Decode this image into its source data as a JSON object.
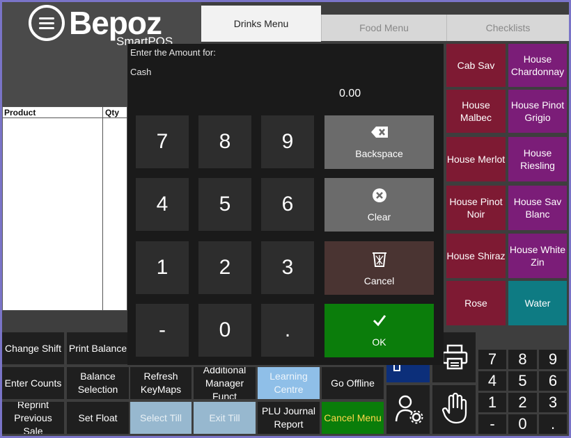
{
  "logo": {
    "brand": "Bepoz",
    "sub": "SmartPOS"
  },
  "tabs": [
    {
      "label": "Drinks Menu",
      "active": true
    },
    {
      "label": "Food Menu",
      "active": false
    },
    {
      "label": "Checklists",
      "active": false
    }
  ],
  "order": {
    "col_product": "Product",
    "col_qty": "Qty"
  },
  "dialog": {
    "prompt": "Enter the Amount for:",
    "tender": "Cash",
    "amount": "0.00",
    "keys": [
      "7",
      "8",
      "9",
      "4",
      "5",
      "6",
      "1",
      "2",
      "3",
      "-",
      "0",
      "."
    ],
    "backspace": "Backspace",
    "clear": "Clear",
    "cancel": "Cancel",
    "ok": "OK"
  },
  "products": [
    {
      "label": "Cab Sav",
      "color": "#7e1a33"
    },
    {
      "label": "House Chardonnay",
      "color": "#7b1d78"
    },
    {
      "label": "House Malbec",
      "color": "#7e1a33"
    },
    {
      "label": "House Pinot Grigio",
      "color": "#7b1d78"
    },
    {
      "label": "House Merlot",
      "color": "#7e1a33"
    },
    {
      "label": "House Riesling",
      "color": "#7b1d78"
    },
    {
      "label": "House Pinot Noir",
      "color": "#7e1a33"
    },
    {
      "label": "House Sav Blanc",
      "color": "#7b1d78"
    },
    {
      "label": "House Shiraz",
      "color": "#7e1a33"
    },
    {
      "label": "House White Zin",
      "color": "#7b1d78"
    },
    {
      "label": "Rose",
      "color": "#7e1a33"
    },
    {
      "label": "Water",
      "color": "#0e7b83"
    }
  ],
  "functions": {
    "change_shift": "Change Shift",
    "print_balance": "Print Balance",
    "enter_counts": "Enter Counts",
    "balance_selection": "Balance Selection",
    "refresh_keymaps": "Refresh KeyMaps",
    "additional_manager": "Additional Manager Funct",
    "learning_centre": "Learning Centre",
    "go_offline": "Go Offline",
    "reprint": "Reprint Previous  Sale",
    "set_float": "Set Float",
    "select_till": "Select Till",
    "exit_till": "Exit Till",
    "plu_journal": "PLU Journal Report",
    "cancel_menu": "Cancel Menu"
  },
  "numpad": [
    "7",
    "8",
    "9",
    "4",
    "5",
    "6",
    "1",
    "2",
    "3",
    "-",
    "0",
    "."
  ],
  "colors": {
    "accent_green": "#0b7d0b",
    "wine": "#7e1a33",
    "purple": "#7b1d78",
    "teal": "#0e7b83"
  }
}
